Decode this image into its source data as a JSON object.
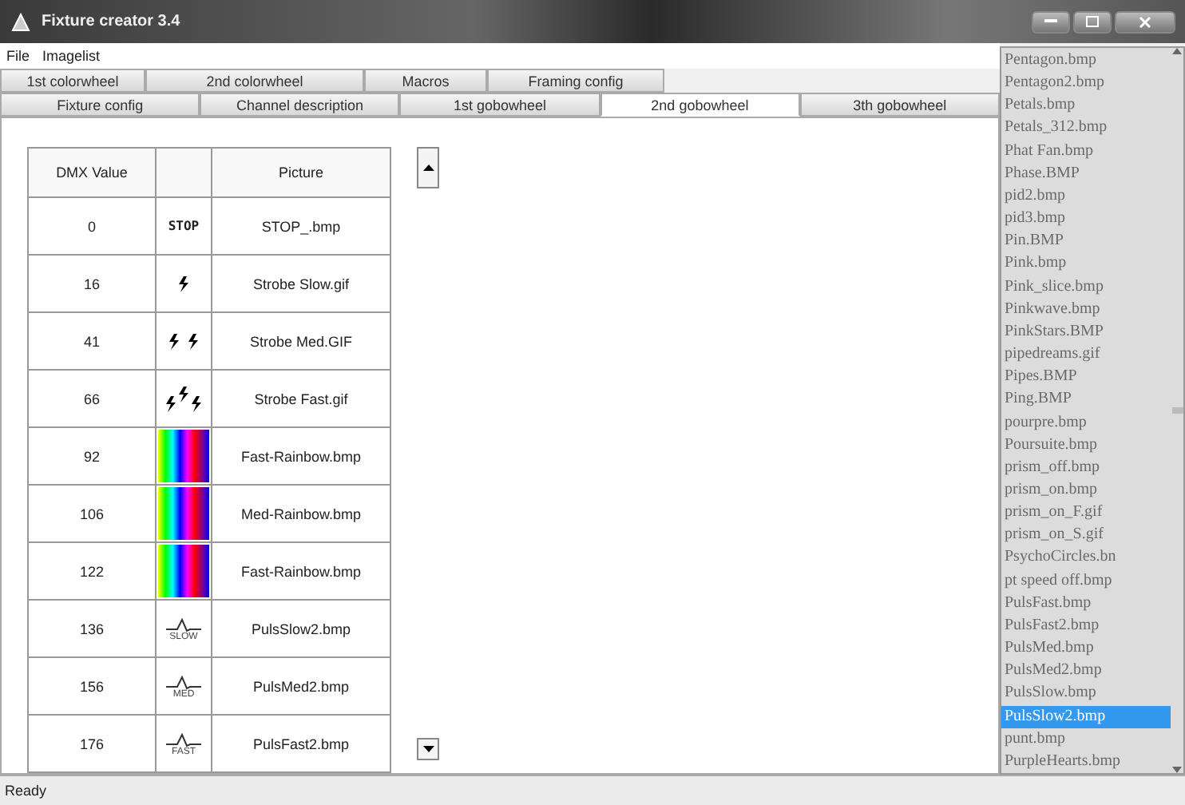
{
  "window": {
    "title": "Fixture creator 3.4"
  },
  "menu": [
    "File",
    "Imagelist"
  ],
  "tabs_back": [
    {
      "label": "1st colorwheel",
      "selected": false
    },
    {
      "label": "2nd colorwheel",
      "selected": false
    },
    {
      "label": "Macros",
      "selected": false
    },
    {
      "label": "Framing config",
      "selected": false
    }
  ],
  "tabs_front": [
    {
      "label": "Fixture config",
      "selected": false
    },
    {
      "label": "Channel description",
      "selected": false
    },
    {
      "label": "1st gobowheel",
      "selected": false
    },
    {
      "label": "2nd gobowheel",
      "selected": true
    },
    {
      "label": "3th gobowheel",
      "selected": false
    }
  ],
  "table": {
    "columns": [
      "DMX Value",
      "Picture"
    ],
    "rows": [
      {
        "value": "0",
        "icon": {
          "kind": "text",
          "text": "STOP"
        },
        "picture": "STOP_.bmp"
      },
      {
        "value": "16",
        "icon": {
          "kind": "strobe1"
        },
        "picture": "Strobe Slow.gif"
      },
      {
        "value": "41",
        "icon": {
          "kind": "strobe2"
        },
        "picture": "Strobe Med.GIF"
      },
      {
        "value": "66",
        "icon": {
          "kind": "strobe3"
        },
        "picture": "Strobe Fast.gif"
      },
      {
        "value": "92",
        "icon": {
          "kind": "rainbow"
        },
        "picture": "Fast-Rainbow.bmp"
      },
      {
        "value": "106",
        "icon": {
          "kind": "rainbow"
        },
        "picture": "Med-Rainbow.bmp"
      },
      {
        "value": "122",
        "icon": {
          "kind": "rainbow"
        },
        "picture": "Fast-Rainbow.bmp"
      },
      {
        "value": "136",
        "icon": {
          "kind": "pulse",
          "text": "SLOW"
        },
        "picture": "PulsSlow2.bmp"
      },
      {
        "value": "156",
        "icon": {
          "kind": "pulse",
          "text": "MED"
        },
        "picture": "PulsMed2.bmp"
      },
      {
        "value": "176",
        "icon": {
          "kind": "pulse",
          "text": "FAST"
        },
        "picture": "PulsFast2.bmp"
      }
    ]
  },
  "image_list": [
    {
      "label": "Pentagon.bmp",
      "selected": false
    },
    {
      "label": "Pentagon2.bmp",
      "selected": false
    },
    {
      "label": "Petals.bmp",
      "selected": false
    },
    {
      "label": "Petals_312.bmp",
      "selected": false
    },
    {
      "label": "Phat Fan.bmp",
      "selected": false
    },
    {
      "label": "Phase.BMP",
      "selected": false
    },
    {
      "label": "pid2.bmp",
      "selected": false
    },
    {
      "label": "pid3.bmp",
      "selected": false
    },
    {
      "label": "Pin.BMP",
      "selected": false
    },
    {
      "label": "Pink.bmp",
      "selected": false
    },
    {
      "label": "Pink_slice.bmp",
      "selected": false
    },
    {
      "label": "Pinkwave.bmp",
      "selected": false
    },
    {
      "label": "PinkStars.BMP",
      "selected": false
    },
    {
      "label": "pipedreams.gif",
      "selected": false
    },
    {
      "label": "Pipes.BMP",
      "selected": false
    },
    {
      "label": "Ping.BMP",
      "selected": false
    },
    {
      "label": "pourpre.bmp",
      "selected": false
    },
    {
      "label": "Poursuite.bmp",
      "selected": false
    },
    {
      "label": "prism_off.bmp",
      "selected": false
    },
    {
      "label": "prism_on.bmp",
      "selected": false
    },
    {
      "label": "prism_on_F.gif",
      "selected": false
    },
    {
      "label": "prism_on_S.gif",
      "selected": false
    },
    {
      "label": "PsychoCircles.bn",
      "selected": false
    },
    {
      "label": "pt speed off.bmp",
      "selected": false
    },
    {
      "label": "PulsFast.bmp",
      "selected": false
    },
    {
      "label": "PulsFast2.bmp",
      "selected": false
    },
    {
      "label": "PulsMed.bmp",
      "selected": false
    },
    {
      "label": "PulsMed2.bmp",
      "selected": false
    },
    {
      "label": "PulsSlow.bmp",
      "selected": false
    },
    {
      "label": "PulsSlow2.bmp",
      "selected": true
    },
    {
      "label": "punt.bmp",
      "selected": false
    },
    {
      "label": "PurpleHearts.bmp",
      "selected": false
    }
  ],
  "status_bar": "Ready"
}
